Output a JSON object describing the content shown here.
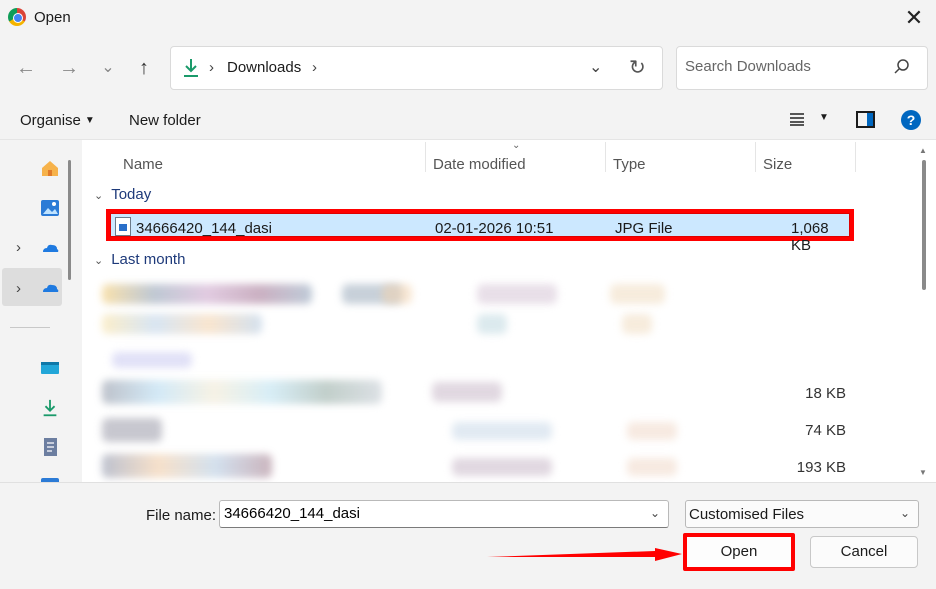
{
  "window": {
    "title": "Open",
    "close_glyph": "✕"
  },
  "nav": {
    "back_glyph": "←",
    "forward_glyph": "→",
    "recent_glyph": "⌄",
    "up_glyph": "↑",
    "breadcrumb_location": "Downloads",
    "search_placeholder": "Search Downloads"
  },
  "commands": {
    "organise": "Organise",
    "new_folder": "New folder",
    "help_glyph": "?"
  },
  "columns": {
    "name": "Name",
    "date_modified": "Date modified",
    "type": "Type",
    "size": "Size"
  },
  "groups": {
    "today": "Today",
    "last_month": "Last month"
  },
  "selected_file": {
    "name": "34666420_144_dasi",
    "date_modified": "02-01-2026 10:51",
    "type": "JPG File",
    "size": "1,068 KB"
  },
  "blurred_sizes": [
    "18 KB",
    "74 KB",
    "193 KB"
  ],
  "footer": {
    "file_name_label": "File name:",
    "file_name_value": "34666420_144_dasi",
    "file_type_selected": "Customised Files",
    "open_label": "Open",
    "cancel_label": "Cancel"
  },
  "colors": {
    "highlight_red": "#ff0000",
    "selection_blue": "#cce8ff",
    "accent": "#0067c0"
  },
  "icons": [
    "app-icon",
    "close-icon",
    "back-icon",
    "forward-icon",
    "recent-locations-icon",
    "up-icon",
    "downloads-icon",
    "refresh-icon",
    "search-icon",
    "view-list-icon",
    "preview-pane-icon",
    "help-icon",
    "home-icon",
    "gallery-icon",
    "onedrive-icon",
    "desktop-icon",
    "documents-icon",
    "jpg-file-icon"
  ]
}
